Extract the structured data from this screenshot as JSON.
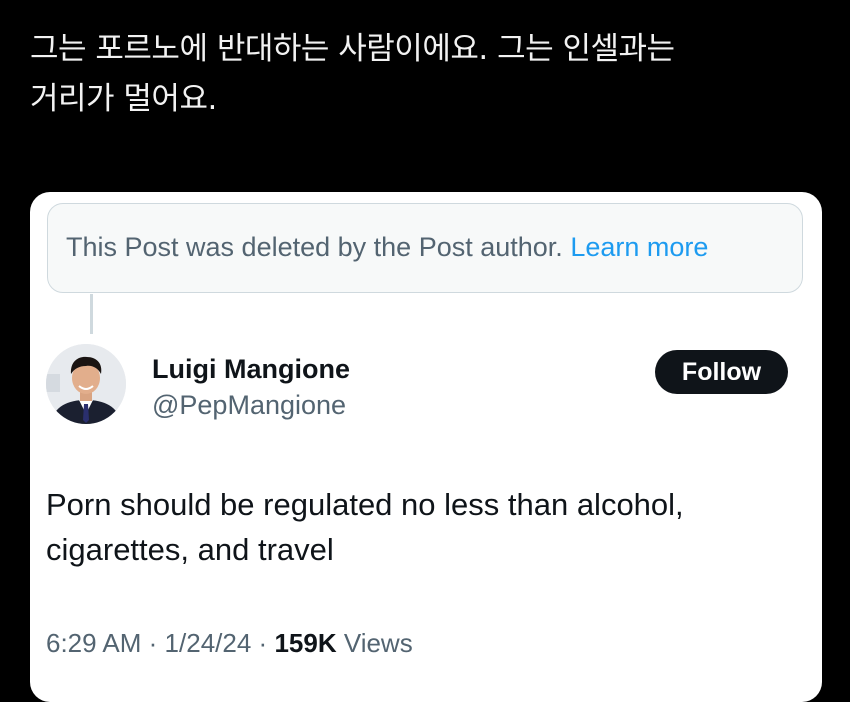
{
  "caption": {
    "line1": "그는 포르노에 반대하는 사람이에요. 그는 인셀과는",
    "line2": "거리가 멀어요."
  },
  "deleted_notice": {
    "text": "This Post was deleted by the Post author.",
    "link": "Learn more"
  },
  "author": {
    "name": "Luigi Mangione",
    "handle": "@PepMangione",
    "follow_label": "Follow"
  },
  "post": {
    "text": "Porn should be regulated no less than alcohol, cigarettes, and travel"
  },
  "meta": {
    "time": "6:29 AM",
    "separator": "·",
    "date": "1/24/24",
    "views_count": "159K",
    "views_label": "Views"
  },
  "colors": {
    "background": "#000000",
    "card": "#ffffff",
    "link": "#1d9bf0",
    "muted": "#536471",
    "button": "#0f1419"
  }
}
